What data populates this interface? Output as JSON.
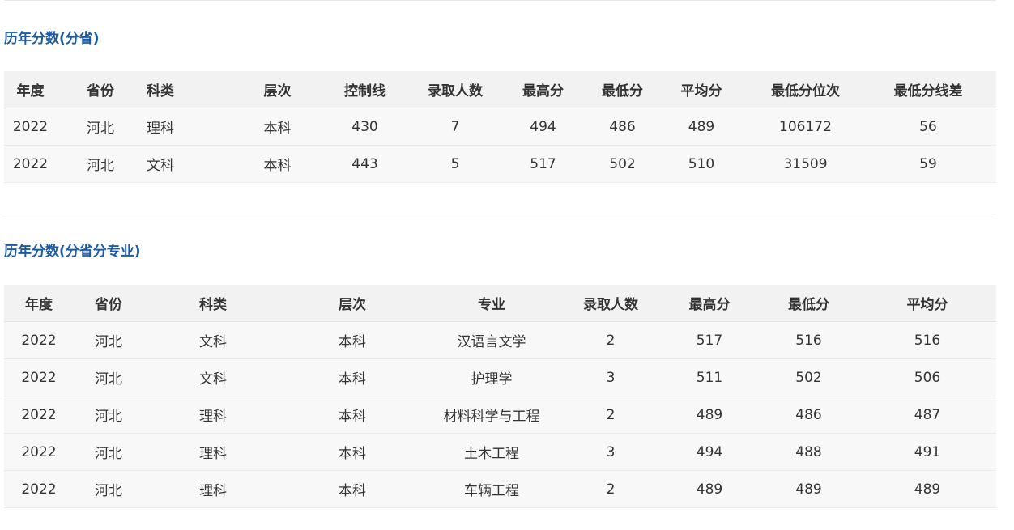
{
  "section1": {
    "title": "历年分数(分省)",
    "headers": [
      "年度",
      "省份",
      "科类",
      "层次",
      "控制线",
      "录取人数",
      "最高分",
      "最低分",
      "平均分",
      "最低分位次",
      "最低分线差"
    ],
    "rows": [
      [
        "2022",
        "河北",
        "理科",
        "本科",
        "430",
        "7",
        "494",
        "486",
        "489",
        "106172",
        "56"
      ],
      [
        "2022",
        "河北",
        "文科",
        "本科",
        "443",
        "5",
        "517",
        "502",
        "510",
        "31509",
        "59"
      ]
    ]
  },
  "section2": {
    "title": "历年分数(分省分专业)",
    "headers": [
      "年度",
      "省份",
      "科类",
      "层次",
      "专业",
      "录取人数",
      "最高分",
      "最低分",
      "平均分"
    ],
    "rows": [
      [
        "2022",
        "河北",
        "文科",
        "本科",
        "汉语言文学",
        "2",
        "517",
        "516",
        "516"
      ],
      [
        "2022",
        "河北",
        "文科",
        "本科",
        "护理学",
        "3",
        "511",
        "502",
        "506"
      ],
      [
        "2022",
        "河北",
        "理科",
        "本科",
        "材料科学与工程",
        "2",
        "489",
        "486",
        "487"
      ],
      [
        "2022",
        "河北",
        "理科",
        "本科",
        "土木工程",
        "3",
        "494",
        "488",
        "491"
      ],
      [
        "2022",
        "河北",
        "理科",
        "本科",
        "车辆工程",
        "2",
        "489",
        "489",
        "489"
      ]
    ]
  }
}
